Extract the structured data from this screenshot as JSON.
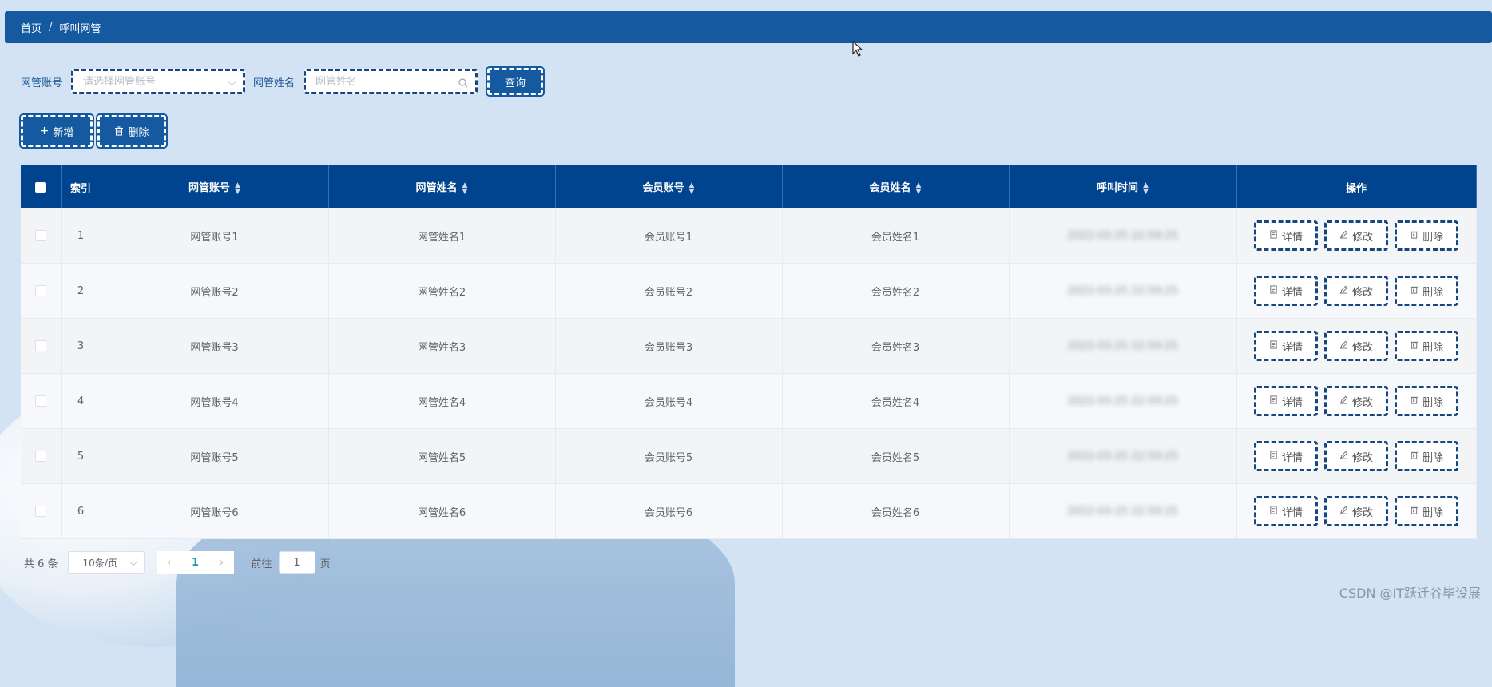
{
  "breadcrumb": {
    "home": "首页",
    "separator": "/",
    "current": "呼叫网管"
  },
  "search": {
    "account_label": "网管账号",
    "account_placeholder": "请选择网管账号",
    "name_label": "网管姓名",
    "name_placeholder": "网管姓名",
    "query_label": "查询"
  },
  "actions": {
    "add_label": "新增",
    "delete_label": "删除"
  },
  "table": {
    "headers": {
      "index": "索引",
      "account": "网管账号",
      "name": "网管姓名",
      "member_account": "会员账号",
      "member_name": "会员姓名",
      "call_time": "呼叫时间",
      "operations": "操作"
    },
    "rows": [
      {
        "index": "1",
        "account": "网管账号1",
        "name": "网管姓名1",
        "member_account": "会员账号1",
        "member_name": "会员姓名1",
        "call_time": "2022-03-25 22:59:25"
      },
      {
        "index": "2",
        "account": "网管账号2",
        "name": "网管姓名2",
        "member_account": "会员账号2",
        "member_name": "会员姓名2",
        "call_time": "2022-03-25 22:59:25"
      },
      {
        "index": "3",
        "account": "网管账号3",
        "name": "网管姓名3",
        "member_account": "会员账号3",
        "member_name": "会员姓名3",
        "call_time": "2022-03-25 22:59:25"
      },
      {
        "index": "4",
        "account": "网管账号4",
        "name": "网管姓名4",
        "member_account": "会员账号4",
        "member_name": "会员姓名4",
        "call_time": "2022-03-25 22:59:25"
      },
      {
        "index": "5",
        "account": "网管账号5",
        "name": "网管姓名5",
        "member_account": "会员账号5",
        "member_name": "会员姓名5",
        "call_time": "2022-03-25 22:59:25"
      },
      {
        "index": "6",
        "account": "网管账号6",
        "name": "网管姓名6",
        "member_account": "会员账号6",
        "member_name": "会员姓名6",
        "call_time": "2022-03-25 22:59:25"
      }
    ],
    "row_ops": {
      "detail": "详情",
      "edit": "修改",
      "delete": "删除"
    }
  },
  "pagination": {
    "total": "共 6 条",
    "page_size": "10条/页",
    "current_page": "1",
    "goto_label": "前往",
    "goto_value": "1",
    "page_unit": "页"
  },
  "watermark": "CSDN @IT跃迁谷毕设展",
  "colors": {
    "header_bar": "#155aa0",
    "table_header": "#00448f",
    "background": "#d4e3f3",
    "active_page": "#1aa094"
  }
}
